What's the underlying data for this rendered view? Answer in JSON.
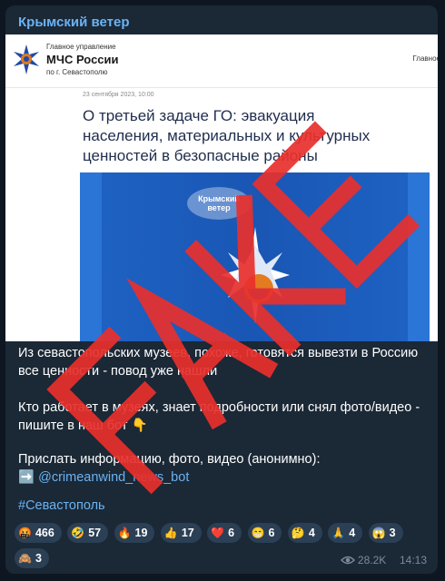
{
  "channel": {
    "name": "Крымский ветер"
  },
  "screenshot": {
    "org_line1": "Главное управление",
    "org_line2": "МЧС России",
    "org_line3": "по г. Севастополю",
    "org_right": "Главное упр",
    "date": "23 сентября 2023, 10:00",
    "title": "О третьей задаче ГО: эвакуация населения, материальных и культурных ценностей в безопасные районы",
    "watermark_line1": "Крымский",
    "watermark_line2": "ветер"
  },
  "overlay": {
    "stamp": "FAKE",
    "color": "#e8302c"
  },
  "message": {
    "p1": "Из севастопольских музеев, похоже, готовятся вывезти в Россию все ценности - повод уже нашли",
    "p2": "Кто работает в музеях, знает подробности или снял фото/видео - пишите в наш бот 👇",
    "p3_text": "Прислать информацию, фото, видео (анонимно):",
    "p3_arrow": "➡️",
    "p3_link": "@crimeanwind_news_bot",
    "hashtag": "#Севастополь"
  },
  "reactions": [
    {
      "emoji": "🤬",
      "count": "466"
    },
    {
      "emoji": "🤣",
      "count": "57"
    },
    {
      "emoji": "🔥",
      "count": "19"
    },
    {
      "emoji": "👍",
      "count": "17"
    },
    {
      "emoji": "❤️",
      "count": "6"
    },
    {
      "emoji": "😁",
      "count": "6"
    },
    {
      "emoji": "🤔",
      "count": "4"
    },
    {
      "emoji": "🙏",
      "count": "4"
    },
    {
      "emoji": "😱",
      "count": "3"
    },
    {
      "emoji": "🙈",
      "count": "3"
    }
  ],
  "meta": {
    "views": "28.2K",
    "time": "14:13"
  },
  "colors": {
    "accent": "#6ab3f3",
    "background": "#0e1621",
    "bubble": "#1b2836"
  }
}
